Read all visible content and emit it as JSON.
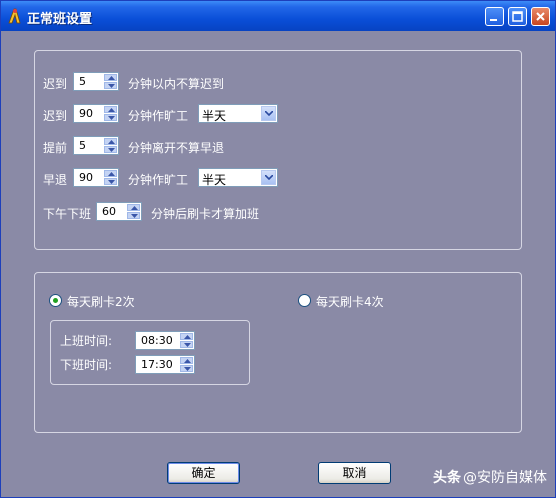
{
  "window": {
    "title": "正常班设置",
    "controls": [
      "minimize-icon",
      "maximize-icon",
      "close-icon"
    ]
  },
  "late": {
    "label": "迟到",
    "minutes": "5",
    "suffix": "分钟以内不算迟到"
  },
  "late_absent": {
    "label": "迟到",
    "minutes": "90",
    "suffix": "分钟作旷工",
    "option": "半天"
  },
  "early": {
    "label": "提前",
    "minutes": "5",
    "suffix": "分钟离开不算早退"
  },
  "early_absent": {
    "label": "早退",
    "minutes": "90",
    "suffix": "分钟作旷工",
    "option": "半天"
  },
  "overtime": {
    "label": "下午下班",
    "minutes": "60",
    "suffix": "分钟后刷卡才算加班"
  },
  "punch_mode": {
    "option_2": "每天刷卡2次",
    "option_4": "每天刷卡4次",
    "selected": "option_2"
  },
  "schedule": {
    "start_label": "上班时间:",
    "start_time": "08:30",
    "end_label": "下班时间:",
    "end_time": "17:30"
  },
  "buttons": {
    "ok": "确定",
    "cancel": "取消"
  },
  "watermark": {
    "logo": "头条",
    "text": "@安防自媒体"
  },
  "colors": {
    "titlebar": "#0a4fd8",
    "dialog_bg": "#8a8aa6",
    "radio_selected": "#21a121"
  }
}
